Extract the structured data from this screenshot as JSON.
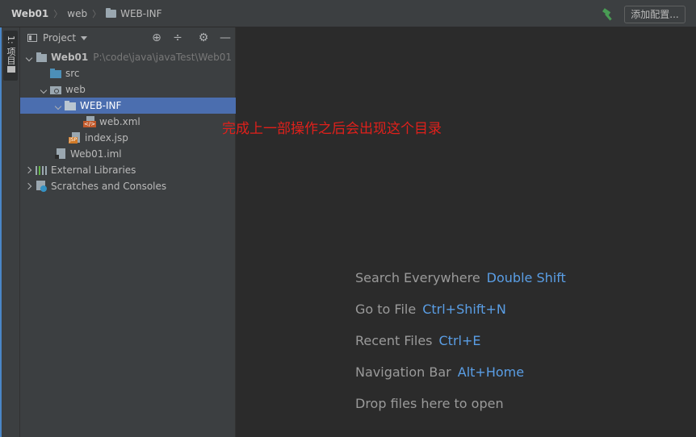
{
  "breadcrumb": {
    "root": "Web01",
    "item1": "web",
    "item2": "WEB-INF"
  },
  "toolbar": {
    "add_config_label": "添加配置..."
  },
  "left_stripe": {
    "tab_label": "1: 项目"
  },
  "project_panel": {
    "title": "Project",
    "tree": [
      {
        "label": "Web01",
        "path": "P:\\code\\java\\javaTest\\Web01"
      },
      {
        "label": "src"
      },
      {
        "label": "web"
      },
      {
        "label": "WEB-INF",
        "selected": true
      },
      {
        "label": "web.xml"
      },
      {
        "label": "index.jsp"
      },
      {
        "label": "Web01.iml"
      },
      {
        "label": "External Libraries"
      },
      {
        "label": "Scratches and Consoles"
      }
    ]
  },
  "annotation": "完成上一部操作之后会出现这个目录",
  "editor_hints": [
    {
      "text": "Search Everywhere",
      "shortcut": "Double Shift"
    },
    {
      "text": "Go to File",
      "shortcut": "Ctrl+Shift+N"
    },
    {
      "text": "Recent Files",
      "shortcut": "Ctrl+E"
    },
    {
      "text": "Navigation Bar",
      "shortcut": "Alt+Home"
    },
    {
      "text": "Drop files here to open",
      "shortcut": ""
    }
  ],
  "colors": {
    "accent": "#4b6eaf",
    "shortcut": "#5a9ee5",
    "annotation": "#e0201b"
  }
}
